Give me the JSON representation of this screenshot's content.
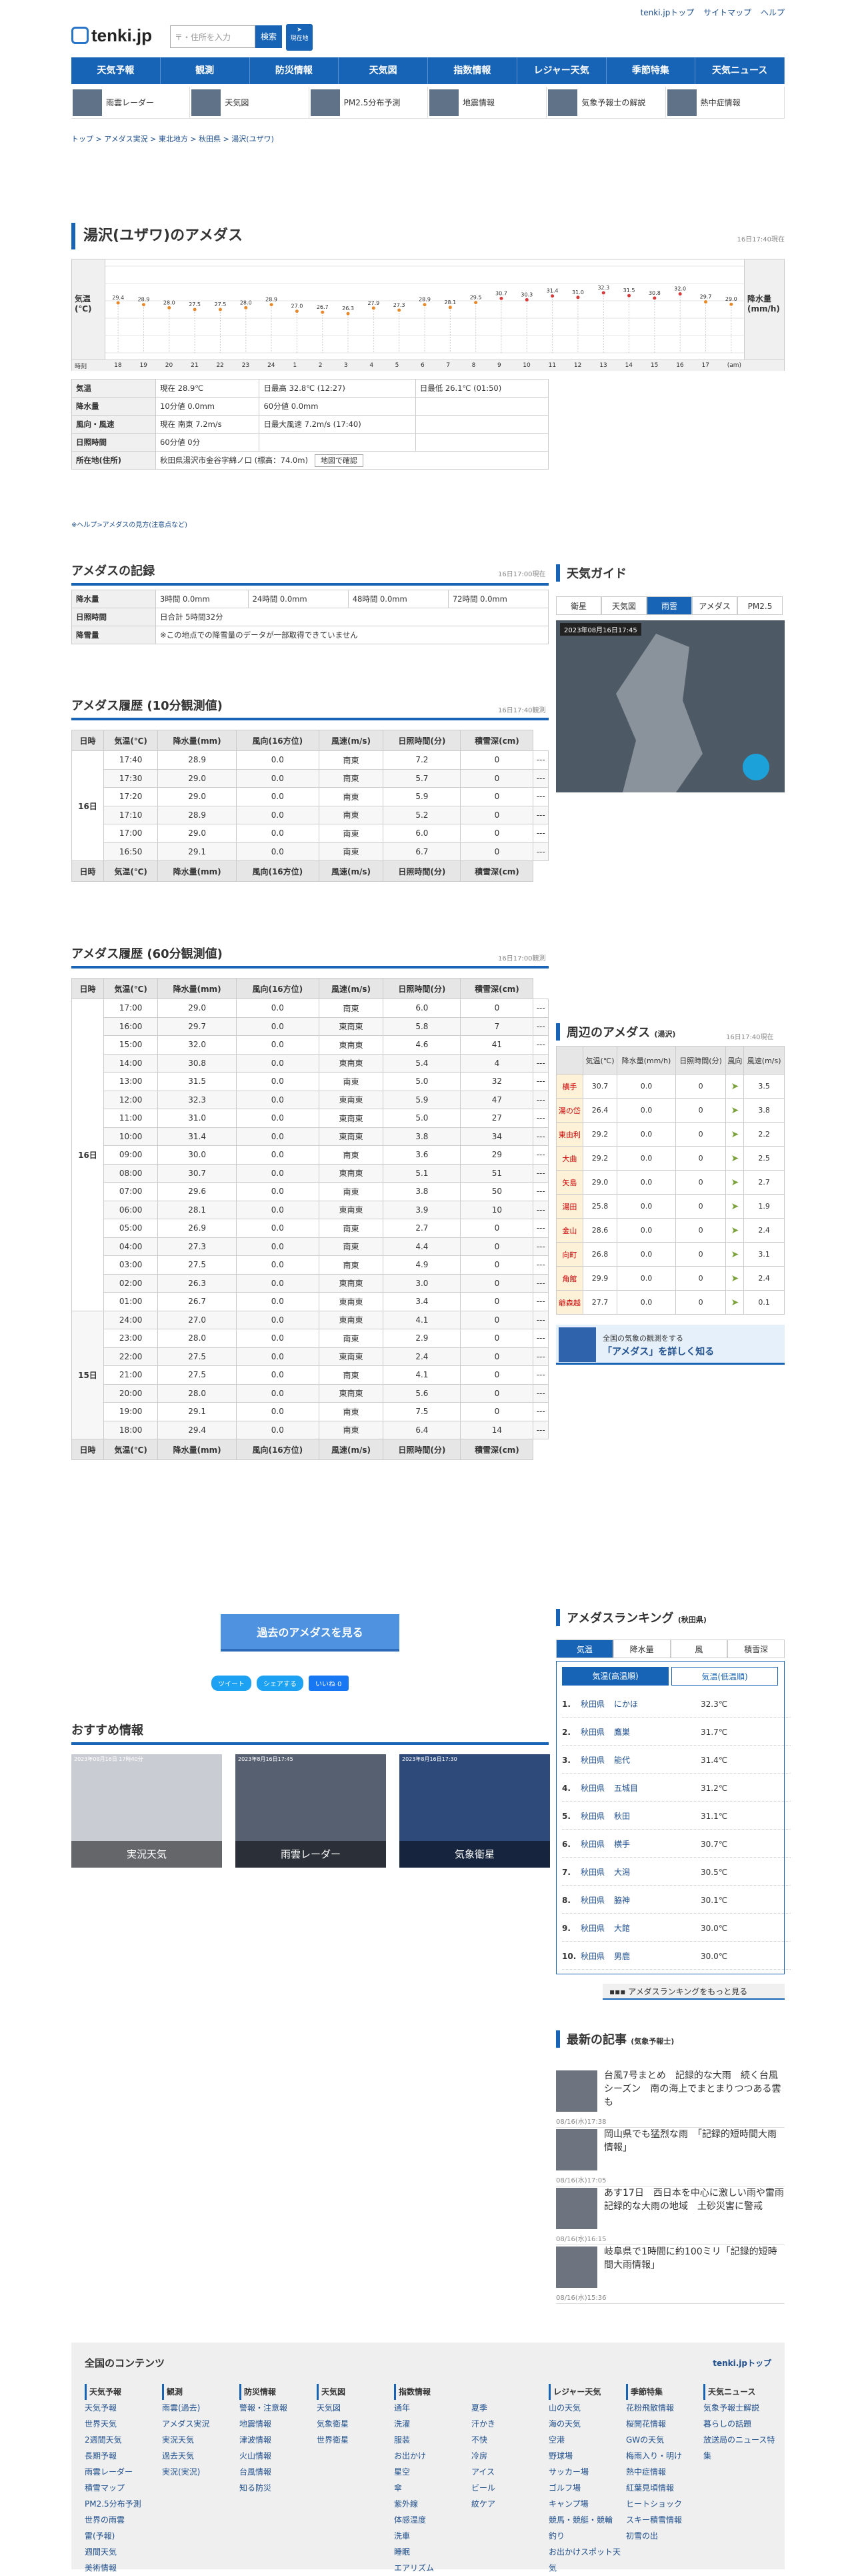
{
  "header": {
    "links": [
      "tenki.jpトップ",
      "サイトマップ",
      "ヘルプ"
    ],
    "logo": "tenki.jp",
    "search_placeholder": "〒・住所を入力",
    "search_btn": "検索",
    "loc_btn": "現在地"
  },
  "gnav": [
    "天気予報",
    "観測",
    "防災情報",
    "天気図",
    "指数情報",
    "レジャー天気",
    "季節特集",
    "天気ニュース"
  ],
  "subnav": [
    "雨雲レーダー",
    "天気図",
    "PM2.5分布予測",
    "地震情報",
    "気象予報士の解説",
    "熱中症情報"
  ],
  "breadcrumb": "トップ > アメダス実況 > 東北地方 > 秋田県 > 湯沢(ユザワ)",
  "page": {
    "title": "湯沢(ユザワ)のアメダス",
    "stamp": "16日17:40現在"
  },
  "graph": {
    "label_left": "気温(℃)",
    "label_right": "降水量(mm/h)",
    "row_time": "時刻",
    "unit": "(am)",
    "temps": [
      "29.4",
      "28.9",
      "28.0",
      "27.5",
      "27.5",
      "28.0",
      "28.9",
      "27.0",
      "26.7",
      "26.3",
      "27.9",
      "27.3",
      "28.9",
      "28.1",
      "29.5",
      "30.7",
      "30.3",
      "31.4",
      "31.0",
      "32.3",
      "31.5",
      "30.8",
      "32.0",
      "29.7",
      "29.0"
    ],
    "hours": [
      "18",
      "19",
      "20",
      "21",
      "22",
      "23",
      "24",
      "1",
      "2",
      "3",
      "4",
      "5",
      "6",
      "7",
      "8",
      "9",
      "10",
      "11",
      "12",
      "13",
      "14",
      "15",
      "16",
      "17",
      ""
    ]
  },
  "current": {
    "rows": [
      {
        "h": "気温",
        "a": "現在 28.9℃",
        "b": "日最高 32.8℃ (12:27)",
        "c": "日最低 26.1℃ (01:50)"
      },
      {
        "h": "降水量",
        "a": "10分値 0.0mm",
        "b": "60分値 0.0mm",
        "c": ""
      },
      {
        "h": "風向・風速",
        "a": "現在 南東 7.2m/s",
        "b": "日最大風速 7.2m/s (17:40)",
        "c": ""
      },
      {
        "h": "日照時間",
        "a": "60分値 0分",
        "b": "",
        "c": ""
      },
      {
        "h": "所在地(住所)",
        "a": "秋田県湯沢市金谷字綿ノ口 (標高：74.0m)",
        "b": "地図で確認",
        "c": ""
      }
    ],
    "note": "※ヘルプ>アメダスの見方(注意点など)"
  },
  "record": {
    "title": "アメダスの記録",
    "stamp": "16日17:00現在",
    "rain": {
      "h": "降水量",
      "v": [
        "3時間 0.0mm",
        "24時間 0.0mm",
        "48時間 0.0mm",
        "72時間 0.0mm"
      ]
    },
    "sun": {
      "h": "日照時間",
      "v": "日合計 5時間32分"
    },
    "snow": {
      "h": "降雪量",
      "v": "※この地点での降雪量のデータが一部取得できていません"
    }
  },
  "hist10": {
    "title": "アメダス履歴 (10分観測値)",
    "stamp": "16日17:40観測",
    "cols": [
      "日時",
      "気温(℃)",
      "降水量(mm)",
      "風向(16方位)",
      "風速(m/s)",
      "日照時間(分)",
      "積雪深(cm)"
    ],
    "day": "16日",
    "rows": [
      [
        "17:40",
        "28.9",
        "0.0",
        "南東",
        "7.2",
        "0",
        "---"
      ],
      [
        "17:30",
        "29.0",
        "0.0",
        "南東",
        "5.7",
        "0",
        "---"
      ],
      [
        "17:20",
        "29.0",
        "0.0",
        "南東",
        "5.9",
        "0",
        "---"
      ],
      [
        "17:10",
        "28.9",
        "0.0",
        "南東",
        "5.2",
        "0",
        "---"
      ],
      [
        "17:00",
        "29.0",
        "0.0",
        "南東",
        "6.0",
        "0",
        "---"
      ],
      [
        "16:50",
        "29.1",
        "0.0",
        "南東",
        "6.7",
        "0",
        "---"
      ]
    ]
  },
  "hist60": {
    "title": "アメダス履歴 (60分観測値)",
    "stamp": "16日17:00観測",
    "days": [
      "16日",
      "15日"
    ],
    "rows": [
      [
        "17:00",
        "29.0",
        "0.0",
        "南東",
        "6.0",
        "0",
        "---"
      ],
      [
        "16:00",
        "29.7",
        "0.0",
        "東南東",
        "5.8",
        "7",
        "---"
      ],
      [
        "15:00",
        "32.0",
        "0.0",
        "東南東",
        "4.6",
        "41",
        "---"
      ],
      [
        "14:00",
        "30.8",
        "0.0",
        "東南東",
        "5.4",
        "4",
        "---"
      ],
      [
        "13:00",
        "31.5",
        "0.0",
        "南東",
        "5.0",
        "32",
        "---"
      ],
      [
        "12:00",
        "32.3",
        "0.0",
        "東南東",
        "5.9",
        "47",
        "---"
      ],
      [
        "11:00",
        "31.0",
        "0.0",
        "東南東",
        "5.0",
        "27",
        "---"
      ],
      [
        "10:00",
        "31.4",
        "0.0",
        "東南東",
        "3.8",
        "34",
        "---"
      ],
      [
        "09:00",
        "30.0",
        "0.0",
        "南東",
        "3.6",
        "29",
        "---"
      ],
      [
        "08:00",
        "30.7",
        "0.0",
        "東南東",
        "5.1",
        "51",
        "---"
      ],
      [
        "07:00",
        "29.6",
        "0.0",
        "南東",
        "3.8",
        "50",
        "---"
      ],
      [
        "06:00",
        "28.1",
        "0.0",
        "東南東",
        "3.9",
        "10",
        "---"
      ],
      [
        "05:00",
        "26.9",
        "0.0",
        "南東",
        "2.7",
        "0",
        "---"
      ],
      [
        "04:00",
        "27.3",
        "0.0",
        "南東",
        "4.4",
        "0",
        "---"
      ],
      [
        "03:00",
        "27.5",
        "0.0",
        "南東",
        "4.9",
        "0",
        "---"
      ],
      [
        "02:00",
        "26.3",
        "0.0",
        "東南東",
        "3.0",
        "0",
        "---"
      ],
      [
        "01:00",
        "26.7",
        "0.0",
        "東南東",
        "3.4",
        "0",
        "---"
      ],
      [
        "24:00",
        "27.0",
        "0.0",
        "東南東",
        "4.1",
        "0",
        "---"
      ],
      [
        "23:00",
        "28.0",
        "0.0",
        "南東",
        "2.9",
        "0",
        "---"
      ],
      [
        "22:00",
        "27.5",
        "0.0",
        "東南東",
        "2.4",
        "0",
        "---"
      ],
      [
        "21:00",
        "27.5",
        "0.0",
        "南東",
        "4.1",
        "0",
        "---"
      ],
      [
        "20:00",
        "28.0",
        "0.0",
        "東南東",
        "5.6",
        "0",
        "---"
      ],
      [
        "19:00",
        "29.1",
        "0.0",
        "南東",
        "7.5",
        "0",
        "---"
      ],
      [
        "18:00",
        "29.4",
        "0.0",
        "南東",
        "6.4",
        "14",
        "---"
      ]
    ]
  },
  "past_btn": "過去のアメダスを見る",
  "share": [
    "ツイート",
    "シェアする",
    "いいね 0"
  ],
  "osusume": {
    "title": "おすすめ情報",
    "items": [
      "実況天気",
      "雨雲レーダー",
      "気象衛星"
    ],
    "stamps": [
      "2023年08月16日 17時40分",
      "2023年8月16日17:45",
      "2023年8月16日17:30"
    ]
  },
  "side": {
    "guide": {
      "title": "天気ガイド",
      "tabs": [
        "衛星",
        "天気図",
        "雨雲",
        "アメダス",
        "PM2.5"
      ],
      "stamp": "2023年08月16日17:45"
    },
    "nearby": {
      "title": "周辺のアメダス",
      "sub": "(湯沢)",
      "stamp": "16日17:40現在",
      "cols": [
        "",
        "気温(℃)",
        "降水量(mm/h)",
        "日照時間(分)",
        "風向",
        "風速(m/s)"
      ],
      "rows": [
        [
          "横手",
          "30.7",
          "0.0",
          "0",
          "3.5"
        ],
        [
          "湯の岱",
          "26.4",
          "0.0",
          "0",
          "3.8"
        ],
        [
          "東由利",
          "29.2",
          "0.0",
          "0",
          "2.2"
        ],
        [
          "大曲",
          "29.2",
          "0.0",
          "0",
          "2.5"
        ],
        [
          "矢島",
          "29.0",
          "0.0",
          "0",
          "2.7"
        ],
        [
          "湯田",
          "25.8",
          "0.0",
          "0",
          "1.9"
        ],
        [
          "金山",
          "28.6",
          "0.0",
          "0",
          "2.4"
        ],
        [
          "向町",
          "26.8",
          "0.0",
          "0",
          "3.1"
        ],
        [
          "角館",
          "29.9",
          "0.0",
          "0",
          "2.4"
        ],
        [
          "爺森越",
          "27.7",
          "0.0",
          "0",
          "0.1"
        ]
      ]
    },
    "banner": {
      "line1": "全国の気象の観測をする",
      "line2": "「アメダス」を詳しく知る"
    },
    "ranking": {
      "title": "アメダスランキング",
      "sub": "(秋田県)",
      "tabs": [
        "気温",
        "降水量",
        "風",
        "積雪深"
      ],
      "subtabs": [
        "気温(高温順)",
        "気温(低温順)"
      ],
      "rows": [
        [
          "1.",
          "秋田県",
          "にかほ",
          "32.3℃"
        ],
        [
          "2.",
          "秋田県",
          "鷹巣",
          "31.7℃"
        ],
        [
          "3.",
          "秋田県",
          "能代",
          "31.4℃"
        ],
        [
          "4.",
          "秋田県",
          "五城目",
          "31.2℃"
        ],
        [
          "5.",
          "秋田県",
          "秋田",
          "31.1℃"
        ],
        [
          "6.",
          "秋田県",
          "横手",
          "30.7℃"
        ],
        [
          "7.",
          "秋田県",
          "大潟",
          "30.5℃"
        ],
        [
          "8.",
          "秋田県",
          "脇神",
          "30.1℃"
        ],
        [
          "9.",
          "秋田県",
          "大館",
          "30.0℃"
        ],
        [
          "10.",
          "秋田県",
          "男鹿",
          "30.0℃"
        ]
      ],
      "more": "アメダスランキングをもっと見る"
    },
    "news": {
      "title": "最新の記事",
      "sub": "(気象予報士)",
      "items": [
        [
          "台風7号まとめ　記録的な大雨　続く台風シーズン　南の海上でまとまりつつある雲も",
          "08/16(水)17:38"
        ],
        [
          "岡山県でも猛烈な雨　「記録的短時間大雨情報」",
          "08/16(水)17:05"
        ],
        [
          "あす17日　西日本を中心に激しい雨や雷雨　記録的な大雨の地域　土砂災害に警戒",
          "08/16(水)16:15"
        ],
        [
          "岐阜県で1時間に約100ミリ「記録的短時間大雨情報」",
          "08/16(水)15:36"
        ]
      ]
    }
  },
  "footer": {
    "title": "全国のコンテンツ",
    "top": "tenki.jpトップ",
    "cols": [
      {
        "h": "天気予報",
        "items": [
          "天気予報",
          "世界天気",
          "2週間天気",
          "長期予報",
          "雨雲レーダー",
          "積雪マップ",
          "PM2.5分布予測",
          "世界の雨雲",
          "雷(予報)",
          "週間天気",
          "美術情報"
        ]
      },
      {
        "h": "観測",
        "items": [
          "雨雲(過去)",
          "アメダス実況",
          "実況天気",
          "過去天気",
          "実況(実況)"
        ]
      },
      {
        "h": "防災情報",
        "items": [
          "警報・注意報",
          "地震情報",
          "津波情報",
          "火山情報",
          "台風情報",
          "知る防災"
        ]
      },
      {
        "h": "天気図",
        "items": [
          "天気図",
          "気象衛星",
          "世界衛星"
        ]
      },
      {
        "h": "指数情報",
        "items": [
          "通年",
          "洗濯",
          "服装",
          "お出かけ",
          "星空",
          "傘",
          "紫外線",
          "体感温度",
          "洗車",
          "睡眠",
          "エアリズム"
        ]
      },
      {
        "h": "",
        "items": [
          "夏季",
          "汗かき",
          "不快",
          "冷房",
          "アイス",
          "ビール",
          "紋ケア"
        ]
      },
      {
        "h": "レジャー天気",
        "items": [
          "山の天気",
          "海の天気",
          "空港",
          "野球場",
          "サッカー場",
          "ゴルフ場",
          "キャンプ場",
          "競馬・競艇・競輪",
          "釣り",
          "お出かけスポット天気"
        ]
      },
      {
        "h": "季節特集",
        "items": [
          "花粉飛散情報",
          "桜開花情報",
          "GWの天気",
          "梅雨入り・明け",
          "熱中症情報",
          "紅葉見頃情報",
          "ヒートショック",
          "スキー積雪情報",
          "初雪の出"
        ]
      },
      {
        "h": "天気ニュース",
        "items": [
          "気象予報士解説",
          "暮らしの話題",
          "放送局のニュース特集"
        ]
      }
    ]
  }
}
